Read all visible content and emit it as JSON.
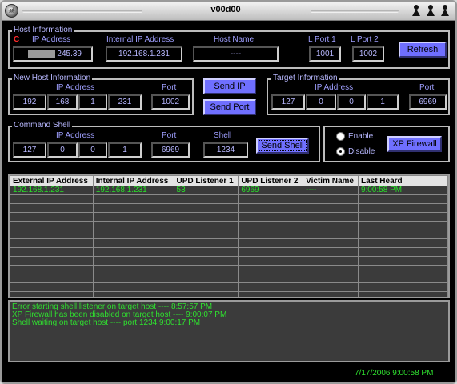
{
  "window": {
    "title": "v00d00"
  },
  "host_info": {
    "legend": "Host Information",
    "flag": "C",
    "ip_label": "IP Address",
    "ip_value": "245.39",
    "internal_ip_label": "Internal IP Address",
    "internal_ip_value": "192.168.1.231",
    "host_name_label": "Host Name",
    "host_name_value": "----",
    "lport1_label": "L Port 1",
    "lport1_value": "1001",
    "lport2_label": "L Port 2",
    "lport2_value": "1002",
    "refresh_label": "Refresh"
  },
  "new_host": {
    "legend": "New Host Information",
    "ip_label": "IP Address",
    "ip": [
      "192",
      "168",
      "1",
      "231"
    ],
    "port_label": "Port",
    "port_value": "1002"
  },
  "send_ip_label": "Send IP",
  "send_port_label": "Send Port",
  "target": {
    "legend": "Target Information",
    "ip_label": "IP Address",
    "ip": [
      "127",
      "0",
      "0",
      "1"
    ],
    "port_label": "Port",
    "port_value": "6969"
  },
  "command_shell": {
    "legend": "Command Shell",
    "ip_label": "IP Address",
    "ip": [
      "127",
      "0",
      "0",
      "1"
    ],
    "port_label": "Port",
    "port_value": "6969",
    "shell_label": "Shell",
    "shell_value": "1234",
    "send_shell_label": "Send Shell"
  },
  "firewall": {
    "enable_label": "Enable",
    "disable_label": "Disable",
    "selected": "Disable",
    "button_label": "XP Firewall"
  },
  "table": {
    "columns": [
      "External IP Address",
      "Internal IP Address",
      "UPD Listener 1",
      "UPD Listener 2",
      "Victim Name",
      "Last Heard"
    ],
    "rows": [
      [
        "192.168.1.231",
        "192.168.1.231",
        "53",
        "6969",
        "----",
        "9:00:58 PM"
      ]
    ]
  },
  "log": [
    "Error starting shell listener on target host ---- 8:57:57 PM",
    "XP Firewall has been disabled on target host ---- 9:00:07 PM",
    "Shell waiting on target host ---- port 1234 9:00:17 PM"
  ],
  "status": {
    "datetime": "7/17/2006 9:00:58 PM"
  },
  "colors": {
    "background": "#000000",
    "accent": "#6f6fff",
    "text_green": "#2fe02f",
    "label_blue": "#9f9fff"
  },
  "icons": [
    "skull-icon",
    "minimize-icon",
    "maximize-icon",
    "close-icon"
  ]
}
